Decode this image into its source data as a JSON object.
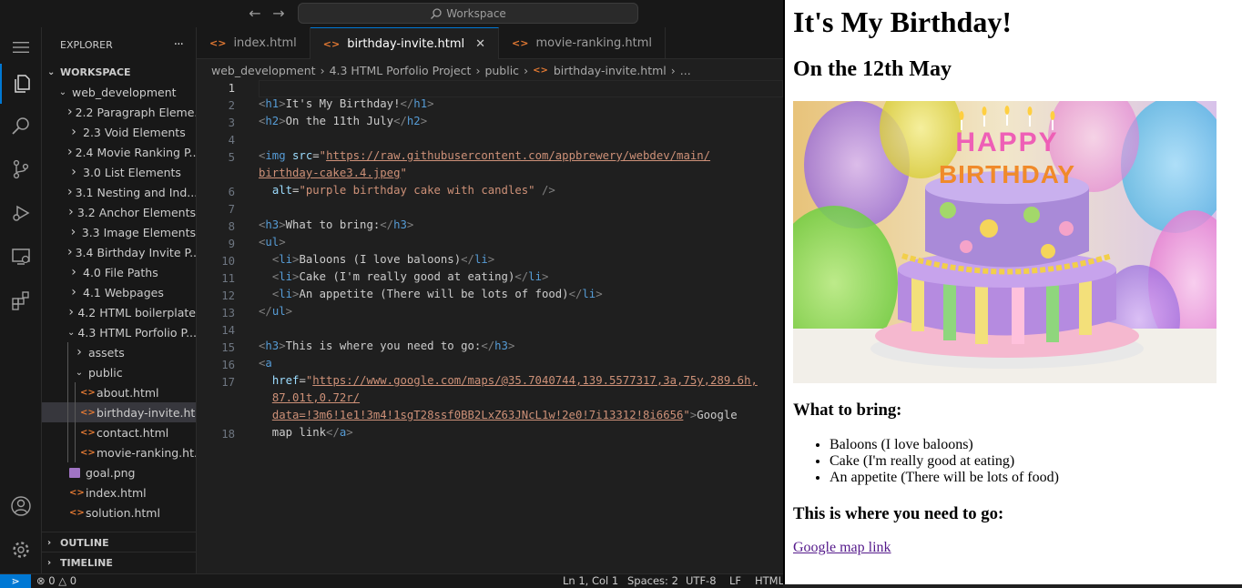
{
  "titlebar": {
    "search_label": "Workspace"
  },
  "sidebar": {
    "title": "EXPLORER",
    "more": "···",
    "workspace": "WORKSPACE",
    "root_folder": "web_development",
    "items": [
      {
        "label": "2.2 Paragraph Eleme...",
        "type": "folder"
      },
      {
        "label": "2.3 Void Elements",
        "type": "folder"
      },
      {
        "label": "2.4 Movie Ranking P...",
        "type": "folder"
      },
      {
        "label": "3.0 List Elements",
        "type": "folder"
      },
      {
        "label": "3.1 Nesting and Ind...",
        "type": "folder"
      },
      {
        "label": "3.2 Anchor Elements",
        "type": "folder"
      },
      {
        "label": "3.3 Image Elements",
        "type": "folder"
      },
      {
        "label": "3.4 Birthday Invite P...",
        "type": "folder"
      },
      {
        "label": "4.0 File Paths",
        "type": "folder"
      },
      {
        "label": "4.1 Webpages",
        "type": "folder"
      },
      {
        "label": "4.2 HTML boilerplate",
        "type": "folder"
      },
      {
        "label": "4.3 HTML Porfolio P...",
        "type": "folder-open"
      },
      {
        "label": "assets",
        "type": "folder"
      },
      {
        "label": "public",
        "type": "folder-open"
      },
      {
        "label": "about.html",
        "type": "html"
      },
      {
        "label": "birthday-invite.ht...",
        "type": "html",
        "selected": true
      },
      {
        "label": "contact.html",
        "type": "html"
      },
      {
        "label": "movie-ranking.ht...",
        "type": "html"
      },
      {
        "label": "goal.png",
        "type": "image"
      },
      {
        "label": "index.html",
        "type": "html"
      },
      {
        "label": "solution.html",
        "type": "html"
      }
    ],
    "outline": "OUTLINE",
    "timeline": "TIMELINE"
  },
  "tabs": [
    {
      "label": "index.html",
      "active": false
    },
    {
      "label": "birthday-invite.html",
      "active": true
    },
    {
      "label": "movie-ranking.html",
      "active": false
    }
  ],
  "breadcrumb": [
    "web_development",
    "4.3 HTML Porfolio Project",
    "public",
    "birthday-invite.html",
    "..."
  ],
  "editor": {
    "line_numbers": [
      "1",
      "2",
      "3",
      "4",
      "5",
      "",
      "6",
      "7",
      "8",
      "9",
      "10",
      "11",
      "12",
      "13",
      "14",
      "15",
      "16",
      "17",
      "",
      "",
      "18",
      ""
    ],
    "current_line": "1"
  },
  "statusbar": {
    "problems": "0",
    "warnings": "0",
    "position": "Ln 1, Col 1",
    "spaces": "Spaces: 2",
    "encoding": "UTF-8",
    "eol": "LF",
    "language": "HTML"
  },
  "preview": {
    "h1": "It's My Birthday!",
    "h2": "On the 12th May",
    "cake_text_top": "HAPPY",
    "cake_text_bottom": "BIRTHDAY",
    "h3_bring": "What to bring:",
    "list": [
      "Baloons (I love baloons)",
      "Cake (I'm really good at eating)",
      "An appetite (There will be lots of food)"
    ],
    "h3_go": "This is where you need to go:",
    "link": "Google map link"
  },
  "colors": {
    "accent": "#0078d4",
    "html_icon": "#e37933",
    "link_visited": "#551a8b"
  }
}
